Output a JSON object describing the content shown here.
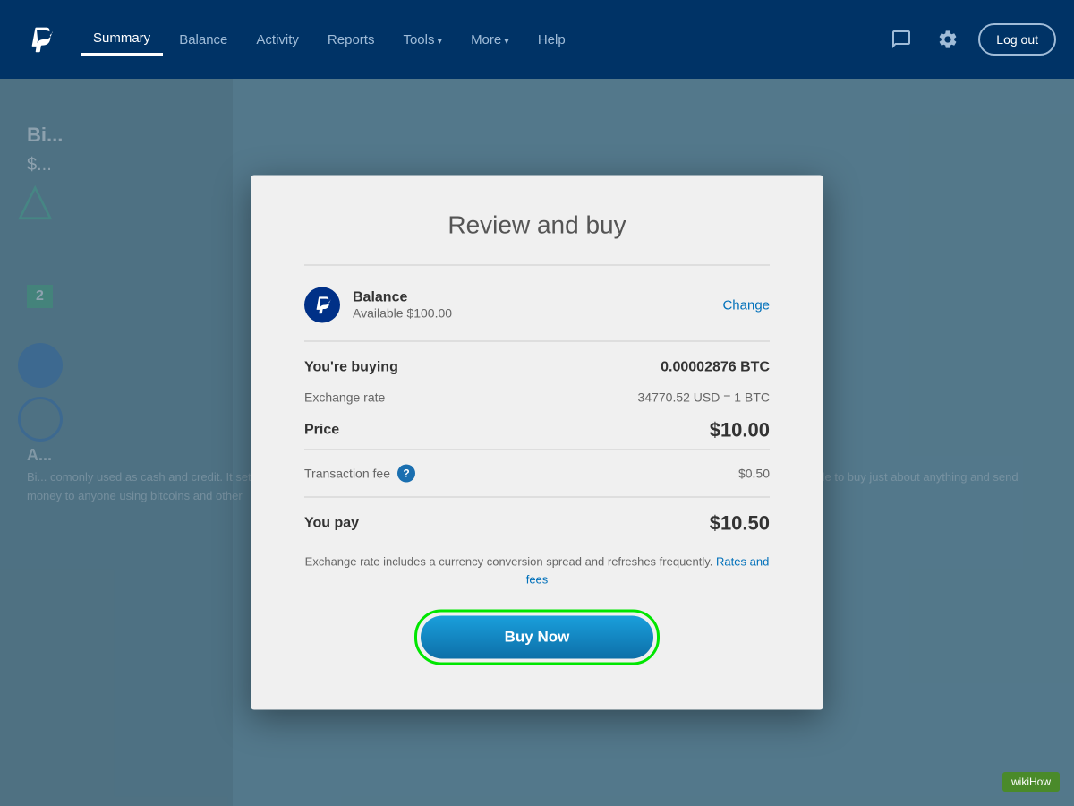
{
  "navbar": {
    "logo_label": "PayPal",
    "links": [
      {
        "id": "summary",
        "label": "Summary",
        "active": true
      },
      {
        "id": "balance",
        "label": "Balance",
        "active": false
      },
      {
        "id": "activity",
        "label": "Activity",
        "active": false
      },
      {
        "id": "reports",
        "label": "Reports",
        "active": false
      },
      {
        "id": "tools",
        "label": "Tools",
        "active": false,
        "dropdown": true
      },
      {
        "id": "more",
        "label": "More",
        "active": false,
        "dropdown": true
      },
      {
        "id": "help",
        "label": "Help",
        "active": false
      }
    ],
    "logout_label": "Log out"
  },
  "background": {
    "title": "Bi...",
    "amount": "$...",
    "badge": "2",
    "heading_a": "A...",
    "body_text": "Bi... comonly used as cash and credit. It set off a revolution that has since inspired thousands of variations on the original. Someday soon, you might be able to buy just about anything and send money to anyone using bitcoins and other"
  },
  "modal": {
    "title": "Review and buy",
    "payment_method": {
      "name": "Balance",
      "available": "Available $100.00",
      "change_label": "Change"
    },
    "you_buying_label": "You're buying",
    "you_buying_value": "0.00002876 BTC",
    "exchange_rate_label": "Exchange rate",
    "exchange_rate_value": "34770.52 USD = 1 BTC",
    "price_label": "Price",
    "price_value": "$10.00",
    "transaction_fee_label": "Transaction fee",
    "transaction_fee_value": "$0.50",
    "you_pay_label": "You pay",
    "you_pay_value": "$10.50",
    "disclaimer_text": "Exchange rate includes a currency conversion spread and refreshes frequently.",
    "rates_fees_label": "Rates and fees",
    "buy_now_label": "Buy Now"
  },
  "wikihow": {
    "label": "wikiHow"
  }
}
